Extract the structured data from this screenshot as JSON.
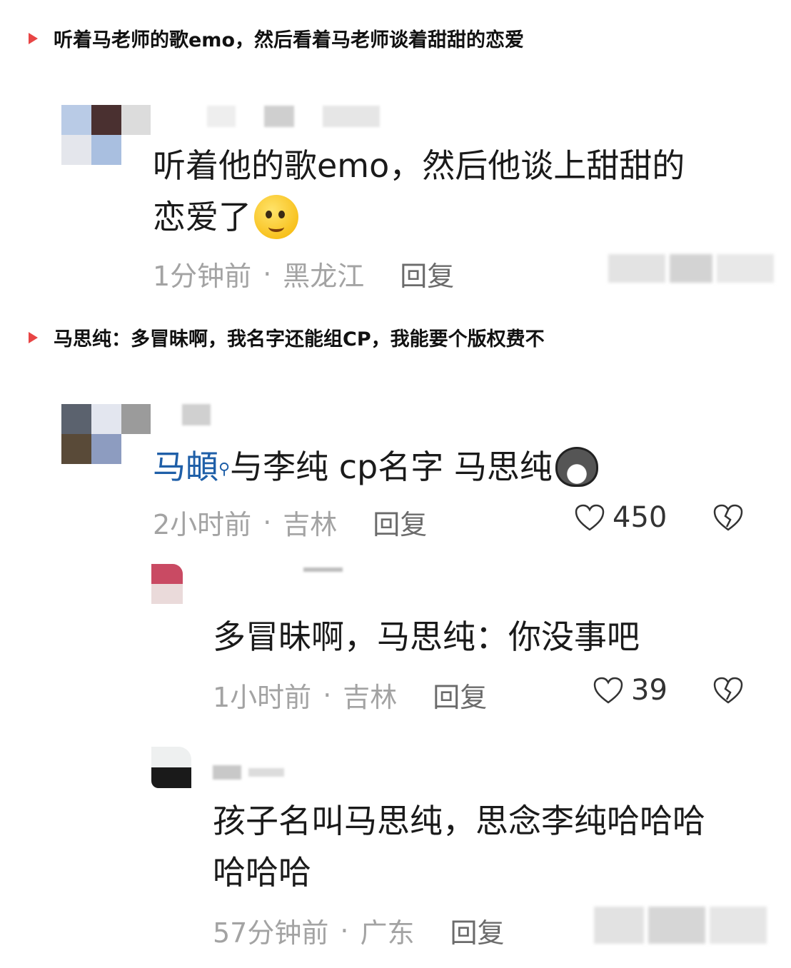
{
  "sections": [
    {
      "heading": "听着马老师的歌emo，然后看着马老师谈着甜甜的恋爱"
    },
    {
      "heading": "马思纯：多冒昧啊，我名字还能组CP，我能要个版权费不"
    }
  ],
  "comments": [
    {
      "line1": "听着他的歌emo，然后他谈上甜甜的",
      "line2": "恋爱了",
      "emoji": "smiling-face-emoji",
      "time": "1分钟前",
      "location": "黑龙江",
      "reply_label": "回复"
    },
    {
      "mention": "马頔",
      "text": "与李纯 cp名字 马思纯",
      "emoji": "dog-face-emoji",
      "time": "2小时前",
      "location": "吉林",
      "reply_label": "回复",
      "likes": "450"
    },
    {
      "text": "多冒昧啊，马思纯：你没事吧",
      "time": "1小时前",
      "location": "吉林",
      "reply_label": "回复",
      "likes": "39"
    },
    {
      "line1": "孩子名叫马思纯，思念李纯哈哈哈",
      "line2": "哈哈哈",
      "time": "57分钟前",
      "location": "广东",
      "reply_label": "回复"
    }
  ],
  "separator": "·",
  "colors": {
    "accent_triangle": "#e84545",
    "mention": "#1f5fa8",
    "meta": "#a3a3a3"
  }
}
